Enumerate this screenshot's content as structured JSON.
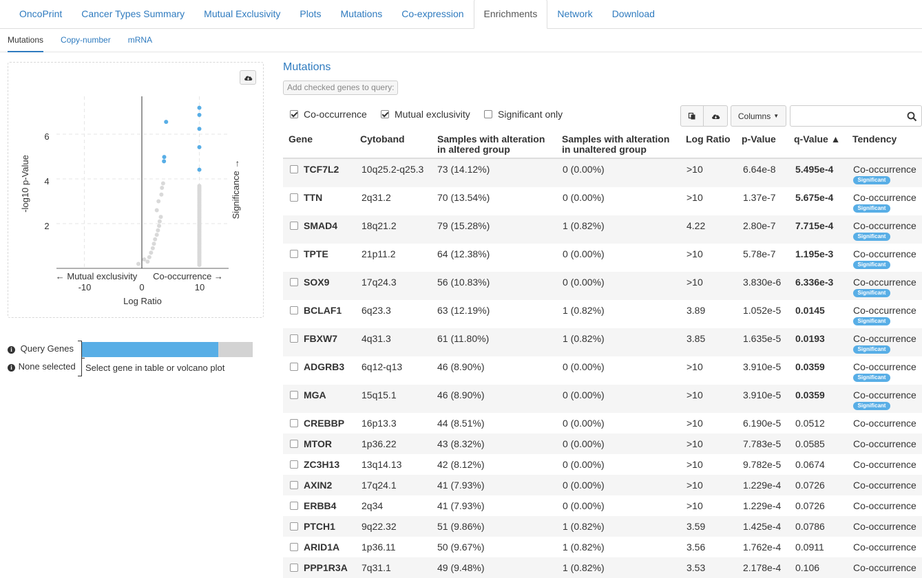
{
  "tabs": [
    "OncoPrint",
    "Cancer Types Summary",
    "Mutual Exclusivity",
    "Plots",
    "Mutations",
    "Co-expression",
    "Enrichments",
    "Network",
    "Download"
  ],
  "active_tab": "Enrichments",
  "subtabs": [
    "Mutations",
    "Copy-number",
    "mRNA"
  ],
  "active_subtab": "Mutations",
  "volcano": {
    "ylabel": "-log10 p-Value",
    "xlabel": "Log Ratio",
    "left_arrow_label": "← Mutual exclusivity",
    "right_arrow_label": "Co-occurrence →",
    "significance_label": "Significance →",
    "x_ticks": [
      "-10",
      "0",
      "10"
    ],
    "y_ticks": [
      "2",
      "4",
      "6"
    ],
    "download_icon": "cloud-download-icon",
    "colors": {
      "significant": "#58aee6",
      "not_significant": "#d9d9d9"
    }
  },
  "legend": {
    "query_genes_label": "Query Genes",
    "none_selected_label": "None selected",
    "hint": "Select gene in table or volcano plot",
    "query_fraction": 0.8,
    "bar_color": "#58aee6",
    "bar_bg": "#d3d3d3"
  },
  "panel": {
    "title": "Mutations",
    "add_button": "Add checked genes to query:",
    "filters": [
      {
        "label": "Co-occurrence",
        "checked": true
      },
      {
        "label": "Mutual exclusivity",
        "checked": true
      },
      {
        "label": "Significant only",
        "checked": false
      }
    ],
    "columns_button": "Columns",
    "search_placeholder": ""
  },
  "table": {
    "headers": {
      "gene": "Gene",
      "cytoband": "Cytoband",
      "alt_line1": "Samples with alteration",
      "alt_line2": "in altered group",
      "unalt_line1": "Samples with alteration",
      "unalt_line2": "in unaltered group",
      "log_ratio": "Log Ratio",
      "p_value": "p-Value",
      "q_value": "q-Value ▲",
      "tendency": "Tendency"
    },
    "significant_badge": "Significant",
    "rows": [
      {
        "gene": "TCF7L2",
        "cytoband": "10q25.2-q25.3",
        "altered": "73 (14.12%)",
        "unaltered": "0 (0.00%)",
        "log_ratio": ">10",
        "p": "6.64e-8",
        "q": "5.495e-4",
        "tendency": "Co-occurrence",
        "sig": true
      },
      {
        "gene": "TTN",
        "cytoband": "2q31.2",
        "altered": "70 (13.54%)",
        "unaltered": "0 (0.00%)",
        "log_ratio": ">10",
        "p": "1.37e-7",
        "q": "5.675e-4",
        "tendency": "Co-occurrence",
        "sig": true
      },
      {
        "gene": "SMAD4",
        "cytoband": "18q21.2",
        "altered": "79 (15.28%)",
        "unaltered": "1 (0.82%)",
        "log_ratio": "4.22",
        "p": "2.80e-7",
        "q": "7.715e-4",
        "tendency": "Co-occurrence",
        "sig": true
      },
      {
        "gene": "TPTE",
        "cytoband": "21p11.2",
        "altered": "64 (12.38%)",
        "unaltered": "0 (0.00%)",
        "log_ratio": ">10",
        "p": "5.78e-7",
        "q": "1.195e-3",
        "tendency": "Co-occurrence",
        "sig": true
      },
      {
        "gene": "SOX9",
        "cytoband": "17q24.3",
        "altered": "56 (10.83%)",
        "unaltered": "0 (0.00%)",
        "log_ratio": ">10",
        "p": "3.830e-6",
        "q": "6.336e-3",
        "tendency": "Co-occurrence",
        "sig": true
      },
      {
        "gene": "BCLAF1",
        "cytoband": "6q23.3",
        "altered": "63 (12.19%)",
        "unaltered": "1 (0.82%)",
        "log_ratio": "3.89",
        "p": "1.052e-5",
        "q": "0.0145",
        "tendency": "Co-occurrence",
        "sig": true
      },
      {
        "gene": "FBXW7",
        "cytoband": "4q31.3",
        "altered": "61 (11.80%)",
        "unaltered": "1 (0.82%)",
        "log_ratio": "3.85",
        "p": "1.635e-5",
        "q": "0.0193",
        "tendency": "Co-occurrence",
        "sig": true
      },
      {
        "gene": "ADGRB3",
        "cytoband": "6q12-q13",
        "altered": "46 (8.90%)",
        "unaltered": "0 (0.00%)",
        "log_ratio": ">10",
        "p": "3.910e-5",
        "q": "0.0359",
        "tendency": "Co-occurrence",
        "sig": true
      },
      {
        "gene": "MGA",
        "cytoband": "15q15.1",
        "altered": "46 (8.90%)",
        "unaltered": "0 (0.00%)",
        "log_ratio": ">10",
        "p": "3.910e-5",
        "q": "0.0359",
        "tendency": "Co-occurrence",
        "sig": true
      },
      {
        "gene": "CREBBP",
        "cytoband": "16p13.3",
        "altered": "44 (8.51%)",
        "unaltered": "0 (0.00%)",
        "log_ratio": ">10",
        "p": "6.190e-5",
        "q": "0.0512",
        "tendency": "Co-occurrence",
        "sig": false
      },
      {
        "gene": "MTOR",
        "cytoband": "1p36.22",
        "altered": "43 (8.32%)",
        "unaltered": "0 (0.00%)",
        "log_ratio": ">10",
        "p": "7.783e-5",
        "q": "0.0585",
        "tendency": "Co-occurrence",
        "sig": false
      },
      {
        "gene": "ZC3H13",
        "cytoband": "13q14.13",
        "altered": "42 (8.12%)",
        "unaltered": "0 (0.00%)",
        "log_ratio": ">10",
        "p": "9.782e-5",
        "q": "0.0674",
        "tendency": "Co-occurrence",
        "sig": false
      },
      {
        "gene": "AXIN2",
        "cytoband": "17q24.1",
        "altered": "41 (7.93%)",
        "unaltered": "0 (0.00%)",
        "log_ratio": ">10",
        "p": "1.229e-4",
        "q": "0.0726",
        "tendency": "Co-occurrence",
        "sig": false
      },
      {
        "gene": "ERBB4",
        "cytoband": "2q34",
        "altered": "41 (7.93%)",
        "unaltered": "0 (0.00%)",
        "log_ratio": ">10",
        "p": "1.229e-4",
        "q": "0.0726",
        "tendency": "Co-occurrence",
        "sig": false
      },
      {
        "gene": "PTCH1",
        "cytoband": "9q22.32",
        "altered": "51 (9.86%)",
        "unaltered": "1 (0.82%)",
        "log_ratio": "3.59",
        "p": "1.425e-4",
        "q": "0.0786",
        "tendency": "Co-occurrence",
        "sig": false
      },
      {
        "gene": "ARID1A",
        "cytoband": "1p36.11",
        "altered": "50 (9.67%)",
        "unaltered": "1 (0.82%)",
        "log_ratio": "3.56",
        "p": "1.762e-4",
        "q": "0.0911",
        "tendency": "Co-occurrence",
        "sig": false
      },
      {
        "gene": "PPP1R3A",
        "cytoband": "7q31.1",
        "altered": "49 (9.48%)",
        "unaltered": "1 (0.82%)",
        "log_ratio": "3.53",
        "p": "2.178e-4",
        "q": "0.106",
        "tendency": "Co-occurrence",
        "sig": false
      }
    ]
  }
}
